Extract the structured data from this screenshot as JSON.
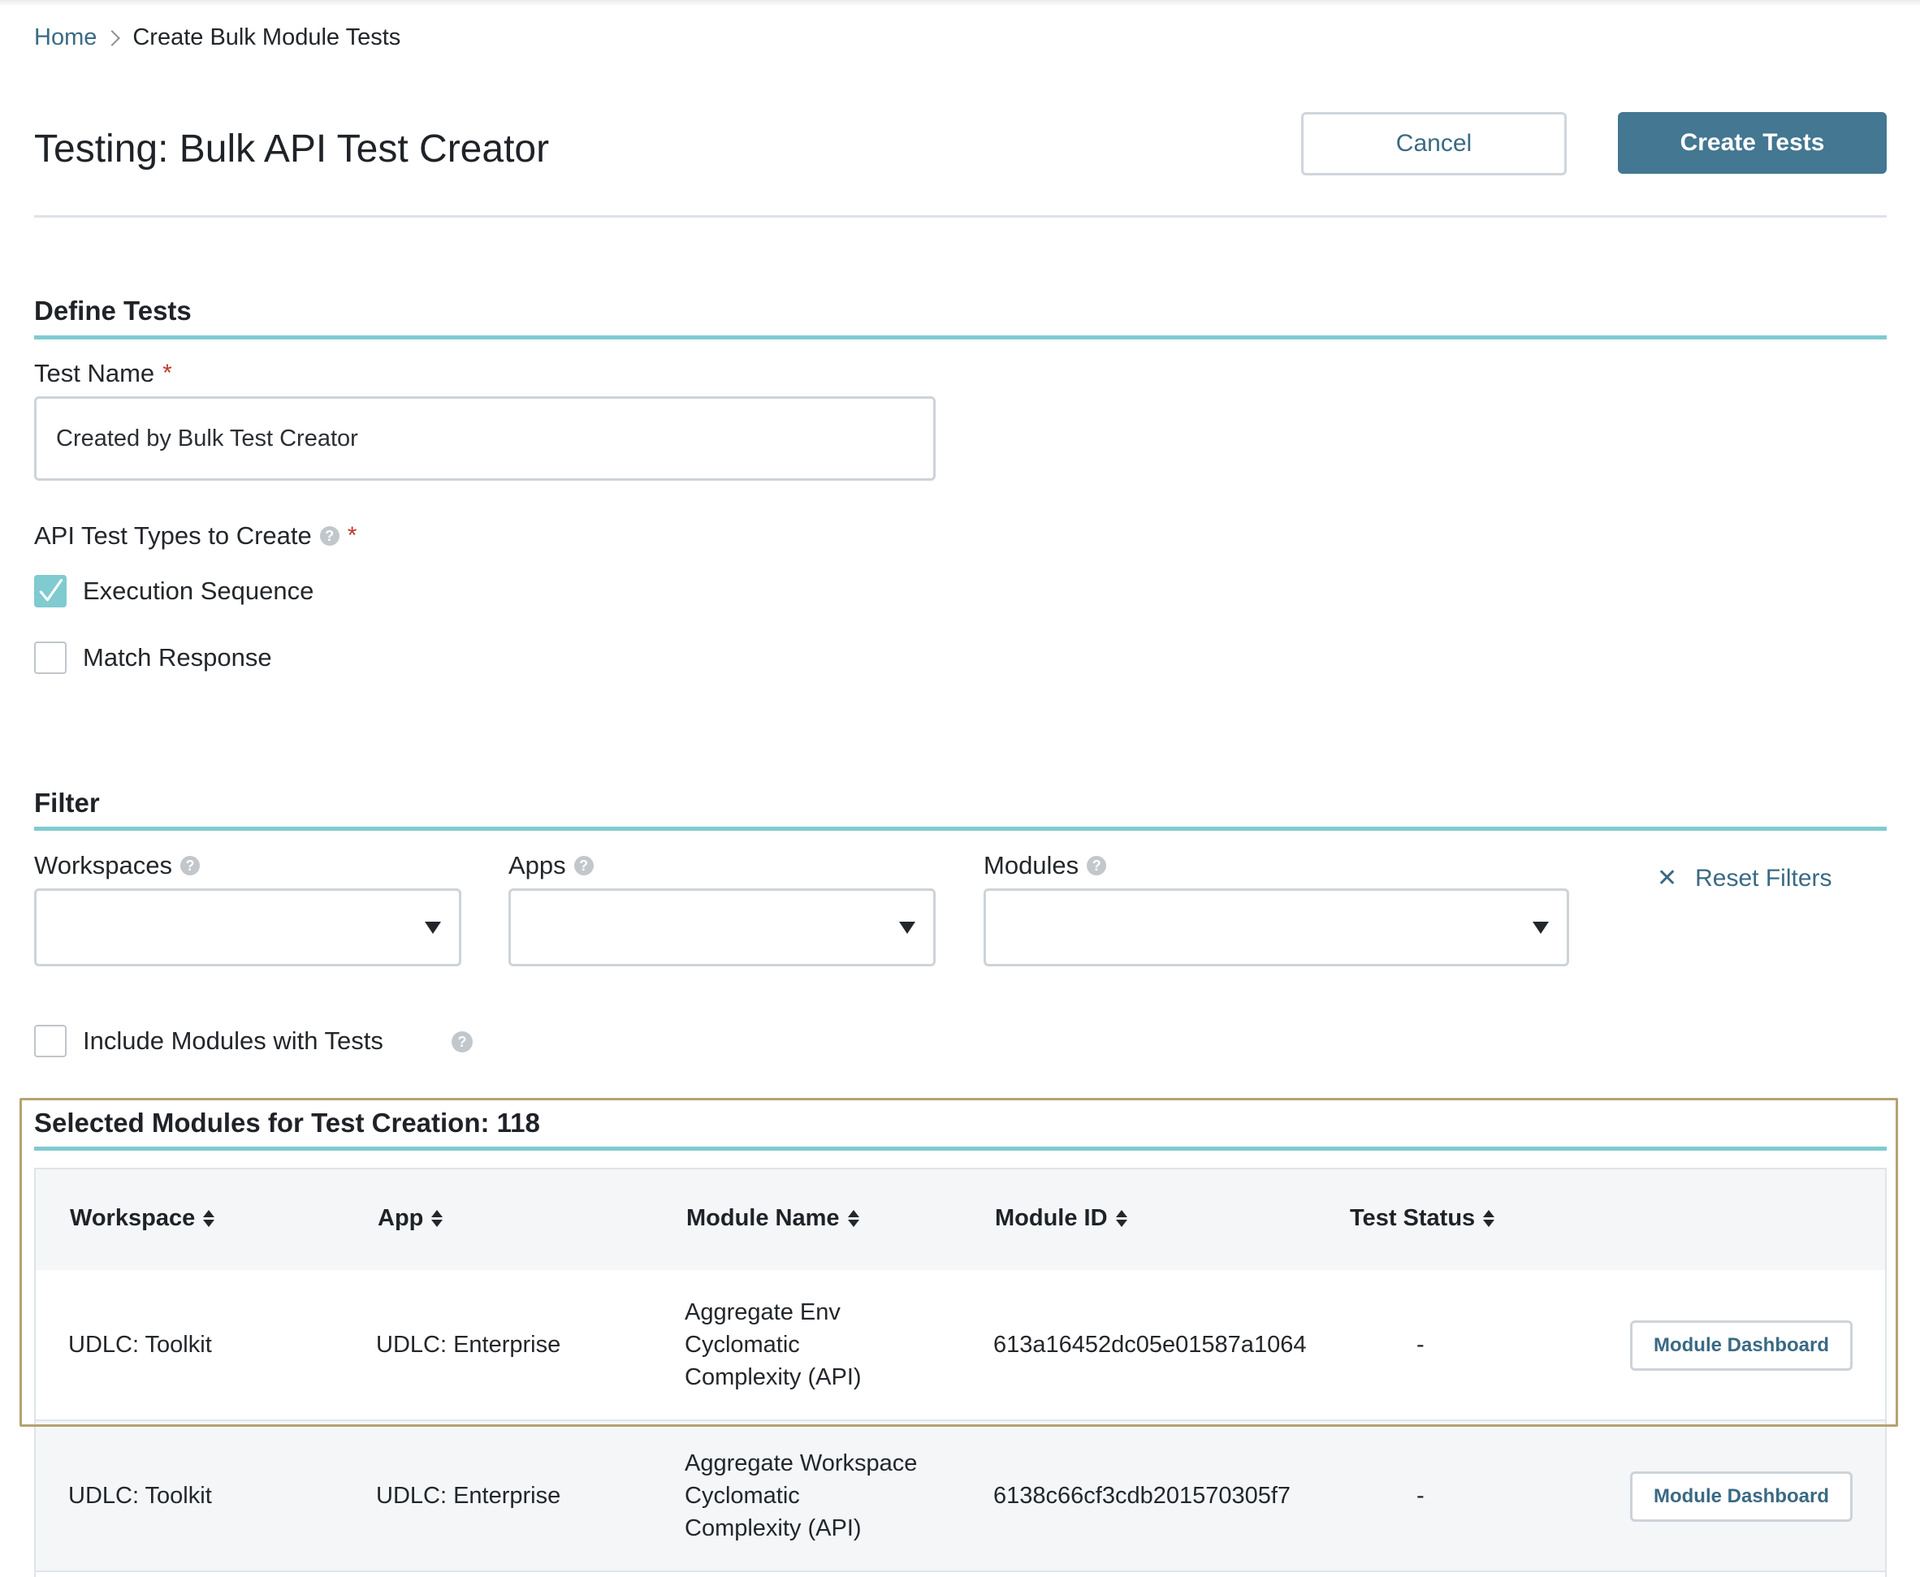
{
  "breadcrumb": {
    "home": "Home",
    "current": "Create Bulk Module Tests"
  },
  "header": {
    "title": "Testing: Bulk API Test Creator",
    "cancel_label": "Cancel",
    "create_label": "Create Tests"
  },
  "define": {
    "title": "Define Tests",
    "test_name_label": "Test Name",
    "required_mark": "*",
    "test_name_value": "Created by Bulk Test Creator",
    "types_label": "API Test Types to Create",
    "help_glyph": "?",
    "options": [
      {
        "label": "Execution Sequence",
        "checked": true
      },
      {
        "label": "Match Response",
        "checked": false
      }
    ]
  },
  "filter": {
    "title": "Filter",
    "workspaces_label": "Workspaces",
    "apps_label": "Apps",
    "modules_label": "Modules",
    "reset_label": "Reset Filters",
    "reset_glyph": "✕",
    "include_label": "Include Modules with Tests",
    "include_checked": false
  },
  "selected": {
    "title": "Selected Modules for Test Creation: 118",
    "columns": [
      "Workspace",
      "App",
      "Module Name",
      "Module ID",
      "Test Status"
    ],
    "rows": [
      {
        "workspace": "UDLC: Toolkit",
        "app": "UDLC: Enterprise",
        "module_name": [
          "Aggregate Env",
          "Cyclomatic",
          "Complexity (API)"
        ],
        "module_id": "613a16452dc05e01587a1064",
        "status": "-",
        "action": "Module Dashboard"
      },
      {
        "workspace": "UDLC: Toolkit",
        "app": "UDLC: Enterprise",
        "module_name": [
          "Aggregate Workspace",
          "Cyclomatic",
          "Complexity (API)"
        ],
        "module_id": "6138c66cf3cdb201570305f7",
        "status": "-",
        "action": "Module Dashboard"
      }
    ]
  },
  "colors": {
    "accent": "#437792",
    "teal_rule": "#7fcbd0",
    "highlight": "#b5a272"
  }
}
